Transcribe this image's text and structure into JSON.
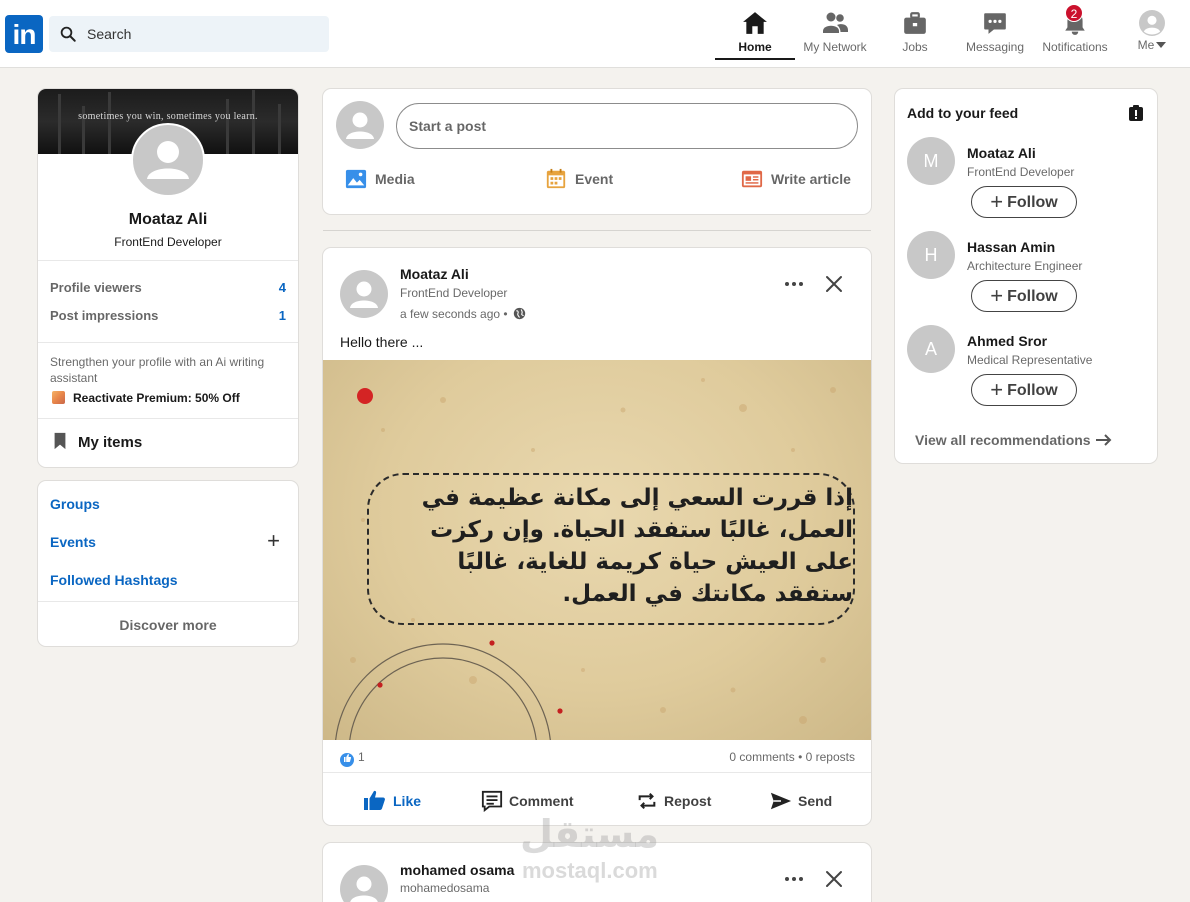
{
  "nav": {
    "logo": "in",
    "search_placeholder": "Search",
    "items": [
      {
        "label": "Home",
        "icon": "home-icon"
      },
      {
        "label": "My Network",
        "icon": "network-icon"
      },
      {
        "label": "Jobs",
        "icon": "briefcase-icon"
      },
      {
        "label": "Messaging",
        "icon": "messaging-icon"
      },
      {
        "label": "Notifications",
        "icon": "bell-icon"
      },
      {
        "label": "Me",
        "icon": "avatar-icon"
      }
    ],
    "notifications_count": "2"
  },
  "profile": {
    "cover_text": "sometimes you win, sometimes you learn.",
    "name": "Moataz Ali",
    "title": "FrontEnd Developer",
    "stats": [
      {
        "label": "Profile viewers",
        "value": "4"
      },
      {
        "label": "Post impressions",
        "value": "1"
      }
    ],
    "promo": "Strengthen your profile with an Ai writing assistant",
    "premium": "Reactivate Premium: 50% Off",
    "my_items": "My items"
  },
  "groups": {
    "groups_label": "Groups",
    "events_label": "Events",
    "hashtags_label": "Followed Hashtags",
    "discover": "Discover more"
  },
  "composer": {
    "placeholder": "Start a post",
    "media": "Media",
    "event": "Event",
    "article": "Write article"
  },
  "posts": [
    {
      "author": "Moataz Ali",
      "subtitle": "FrontEnd Developer",
      "time": "a few seconds ago •",
      "text": "Hello there ...",
      "image_quote": "إذا قررت السعي إلى مكانة عظيمة في العمل، غالبًا ستفقد الحياة. وإن ركزت على العيش حياة كريمة للغاية، غالبًا ستفقد مكانتك في العمل.",
      "likes": "1",
      "comments_reposts": "0 comments • 0 reposts",
      "actions": [
        "Like",
        "Comment",
        "Repost",
        "Send"
      ]
    },
    {
      "author": "mohamed osama",
      "subtitle": "mohamedosama"
    }
  ],
  "feed": {
    "title": "Add to your feed",
    "recommendations": [
      {
        "initial": "M",
        "name": "Moataz Ali",
        "title": "FrontEnd Developer"
      },
      {
        "initial": "H",
        "name": "Hassan Amin",
        "title": "Architecture Engineer"
      },
      {
        "initial": "A",
        "name": "Ahmed Sror",
        "title": "Medical Representative"
      }
    ],
    "follow_label": "Follow",
    "view_all": "View all recommendations"
  },
  "watermark": {
    "arabic": "مستقل",
    "latin": "mostaql.com"
  },
  "colors": {
    "brand": "#0a66c2",
    "badge": "#cb112d",
    "background": "#f4f2ee"
  }
}
